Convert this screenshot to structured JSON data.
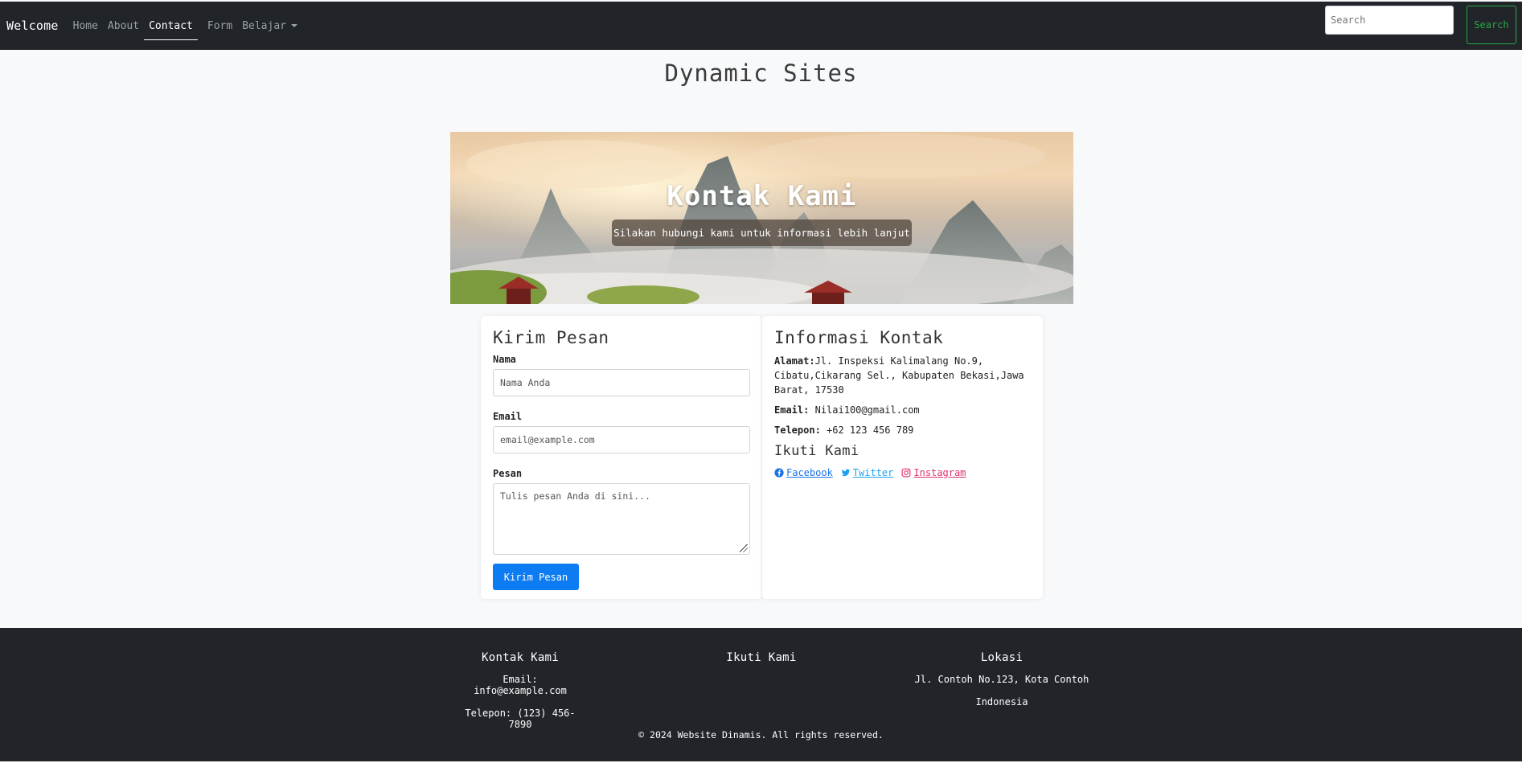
{
  "navbar": {
    "brand": "Welcome",
    "links": [
      "Home",
      "About",
      "Contact",
      "Form",
      "Belajar"
    ],
    "search_placeholder": "Search",
    "search_button": "Search"
  },
  "header": {
    "title": "Dynamic Sites"
  },
  "hero": {
    "title": "Kontak Kami",
    "subtitle": "Silakan hubungi kami untuk informasi lebih lanjut"
  },
  "form_card": {
    "title": "Kirim Pesan",
    "name_label": "Nama",
    "name_placeholder": "Nama Anda",
    "email_label": "Email",
    "email_placeholder": "email@example.com",
    "message_label": "Pesan",
    "message_placeholder": "Tulis pesan Anda di sini...",
    "submit": "Kirim Pesan"
  },
  "info_card": {
    "title": "Informasi Kontak",
    "address_label": "Alamat:",
    "address_value": "Jl. Inspeksi Kalimalang No.9, Cibatu,Cikarang Sel., Kabupaten Bekasi,Jawa Barat, 17530",
    "email_label": "Email:",
    "email_value": "Nilai100@gmail.com",
    "phone_label": "Telepon:",
    "phone_value": "+62 123 456 789",
    "follow_title": "Ikuti Kami",
    "social": [
      {
        "label": " Facebook",
        "icon": "facebook-icon"
      },
      {
        "label": " Twitter",
        "icon": "twitter-icon"
      },
      {
        "label": " Instagram",
        "icon": "instagram-icon"
      }
    ]
  },
  "footer": {
    "contact_title": "Kontak Kami",
    "contact_email": "Email: info@example.com",
    "contact_phone": "Telepon: (123) 456-7890",
    "follow_title": "Ikuti Kami",
    "location_title": "Lokasi",
    "location_line1": "Jl. Contoh No.123, Kota Contoh",
    "location_line2": "Indonesia",
    "copyright": "© 2024 Website Dinamis. All rights reserved."
  },
  "colors": {
    "navbar_bg": "#212529",
    "accent_blue": "#0d7cf2",
    "search_green": "#28a745"
  }
}
